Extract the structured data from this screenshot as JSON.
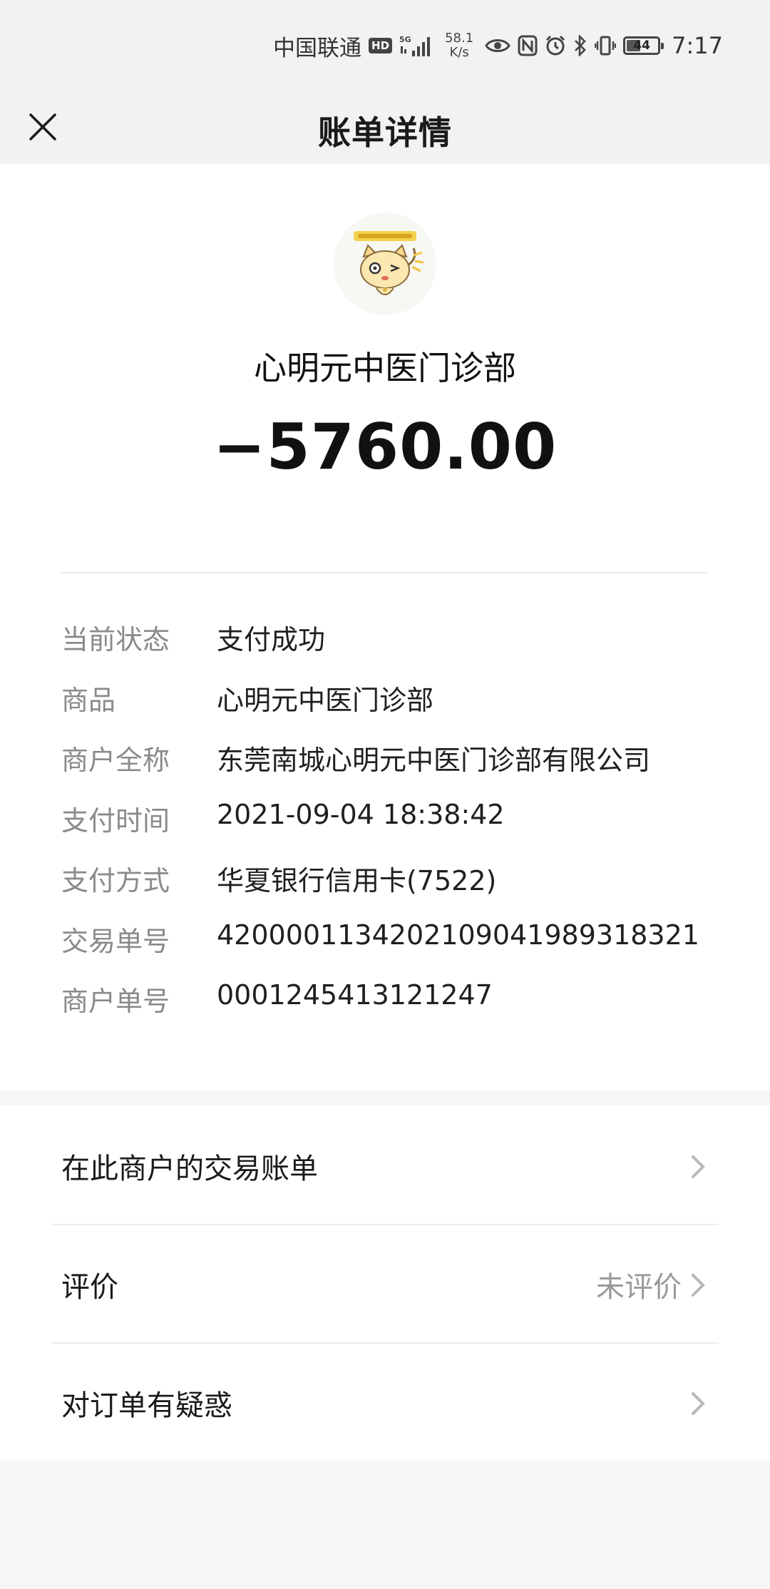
{
  "status_bar": {
    "carrier": "中国联通",
    "hd_badge": "HD",
    "net_type": "5G",
    "speed_value": "58.1",
    "speed_unit": "K/s",
    "battery": "44",
    "time": "7:17"
  },
  "nav": {
    "title": "账单详情"
  },
  "bill": {
    "merchant_name": "心明元中医门诊部",
    "amount": "−5760.00",
    "details": [
      {
        "label": "当前状态",
        "value": "支付成功"
      },
      {
        "label": "商品",
        "value": "心明元中医门诊部"
      },
      {
        "label": "商户全称",
        "value": "东莞南城心明元中医门诊部有限公司"
      },
      {
        "label": "支付时间",
        "value": "2021-09-04 18:38:42"
      },
      {
        "label": "支付方式",
        "value": "华夏银行信用卡(7522)"
      },
      {
        "label": "交易单号",
        "value": "4200001134202109041989318321"
      },
      {
        "label": "商户单号",
        "value": "0001245413121247"
      }
    ]
  },
  "menu": [
    {
      "label": "在此商户的交易账单",
      "value": ""
    },
    {
      "label": "评价",
      "value": "未评价"
    },
    {
      "label": "对订单有疑惑",
      "value": ""
    }
  ],
  "colors": {
    "page_bg": "#f6f6f6",
    "header_bg": "#f2f2f2",
    "label_gray": "#8a8a8a",
    "text_dark": "#1a1a1a"
  }
}
